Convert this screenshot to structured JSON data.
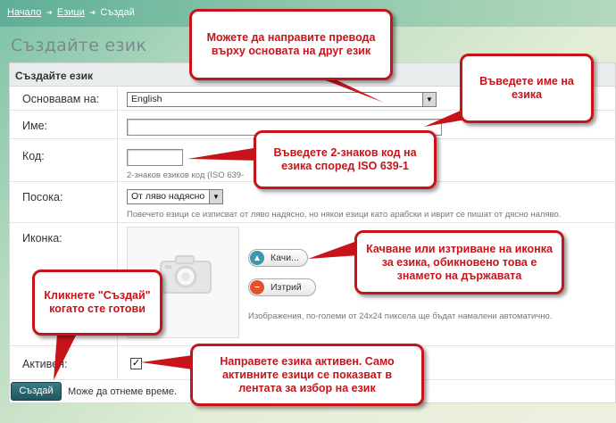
{
  "breadcrumb": {
    "home": "Начало",
    "languages": "Езици",
    "current": "Създай"
  },
  "page_title": "Създайте език",
  "panel_header": "Създайте език",
  "form": {
    "base_label": "Основавам на:",
    "base_value": "English",
    "name_label": "Име:",
    "name_value": "",
    "code_label": "Код:",
    "code_value": "",
    "code_hint": "2-знаков езиков код (ISO 639-",
    "direction_label": "Посока:",
    "direction_value": "От ляво надясно",
    "direction_hint": "Повечето езици се изписват от ляво надясно, но някои езици като арабски и иврит се пишат от дясно наляво.",
    "icon_label": "Иконка:",
    "upload_label": "Качи...",
    "delete_label": "Изтрий",
    "icon_hint": "Изображения, по-големи от 24x24 пиксела ще бъдат намалени автоматично.",
    "active_label": "Активен:",
    "active_checked": true
  },
  "submit_label": "Създай",
  "footer_note": "Може да отнеме време.",
  "callouts": {
    "translate_based": "Можете да направите превода върху основата на друг език",
    "enter_name": "Въведете име на езика",
    "enter_code": "Въведете 2-знаков код на езика според ISO 639-1",
    "upload_icon": "Качване или изтриване на иконка за езика, обикновено това е знамето на държавата",
    "click_create": "Кликнете \"Създай\" когато сте готови",
    "make_active": "Направете езика активен. Само активните езици се показват в лентата за избор на език"
  },
  "colors": {
    "callout_red": "#c6141a",
    "submit_bg": "#2a6772",
    "upload_icon": "#3f96ad",
    "delete_icon": "#e0522c"
  }
}
